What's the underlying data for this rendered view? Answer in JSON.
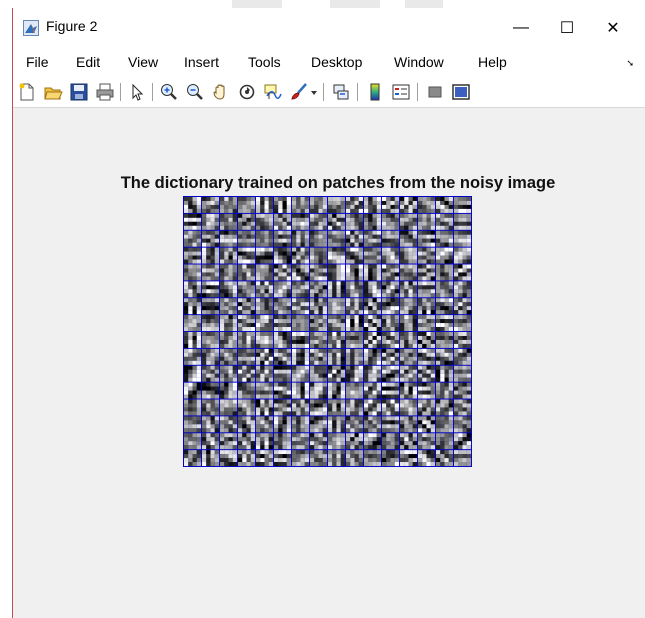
{
  "window": {
    "title": "Figure 2",
    "controls": {
      "minimize": "—",
      "maximize": "☐",
      "close": "✕"
    }
  },
  "menu": {
    "items": [
      "File",
      "Edit",
      "View",
      "Insert",
      "Tools",
      "Desktop",
      "Window",
      "Help"
    ]
  },
  "toolbar": {
    "icons": [
      "new-figure-icon",
      "open-file-icon",
      "save-icon",
      "print-icon",
      "edit-plot-arrow-icon",
      "zoom-in-icon",
      "zoom-out-icon",
      "pan-hand-icon",
      "rotate-3d-icon",
      "data-cursor-icon",
      "brush-icon",
      "brush-dropdown-icon",
      "link-plot-icon",
      "colorbar-icon",
      "legend-icon",
      "hide-plot-tools-icon",
      "show-plot-tools-icon"
    ]
  },
  "figure": {
    "title": "The dictionary trained on patches from the noisy image",
    "grid_rows": 16,
    "grid_cols": 16,
    "grid_line_color": "#0000cc"
  }
}
